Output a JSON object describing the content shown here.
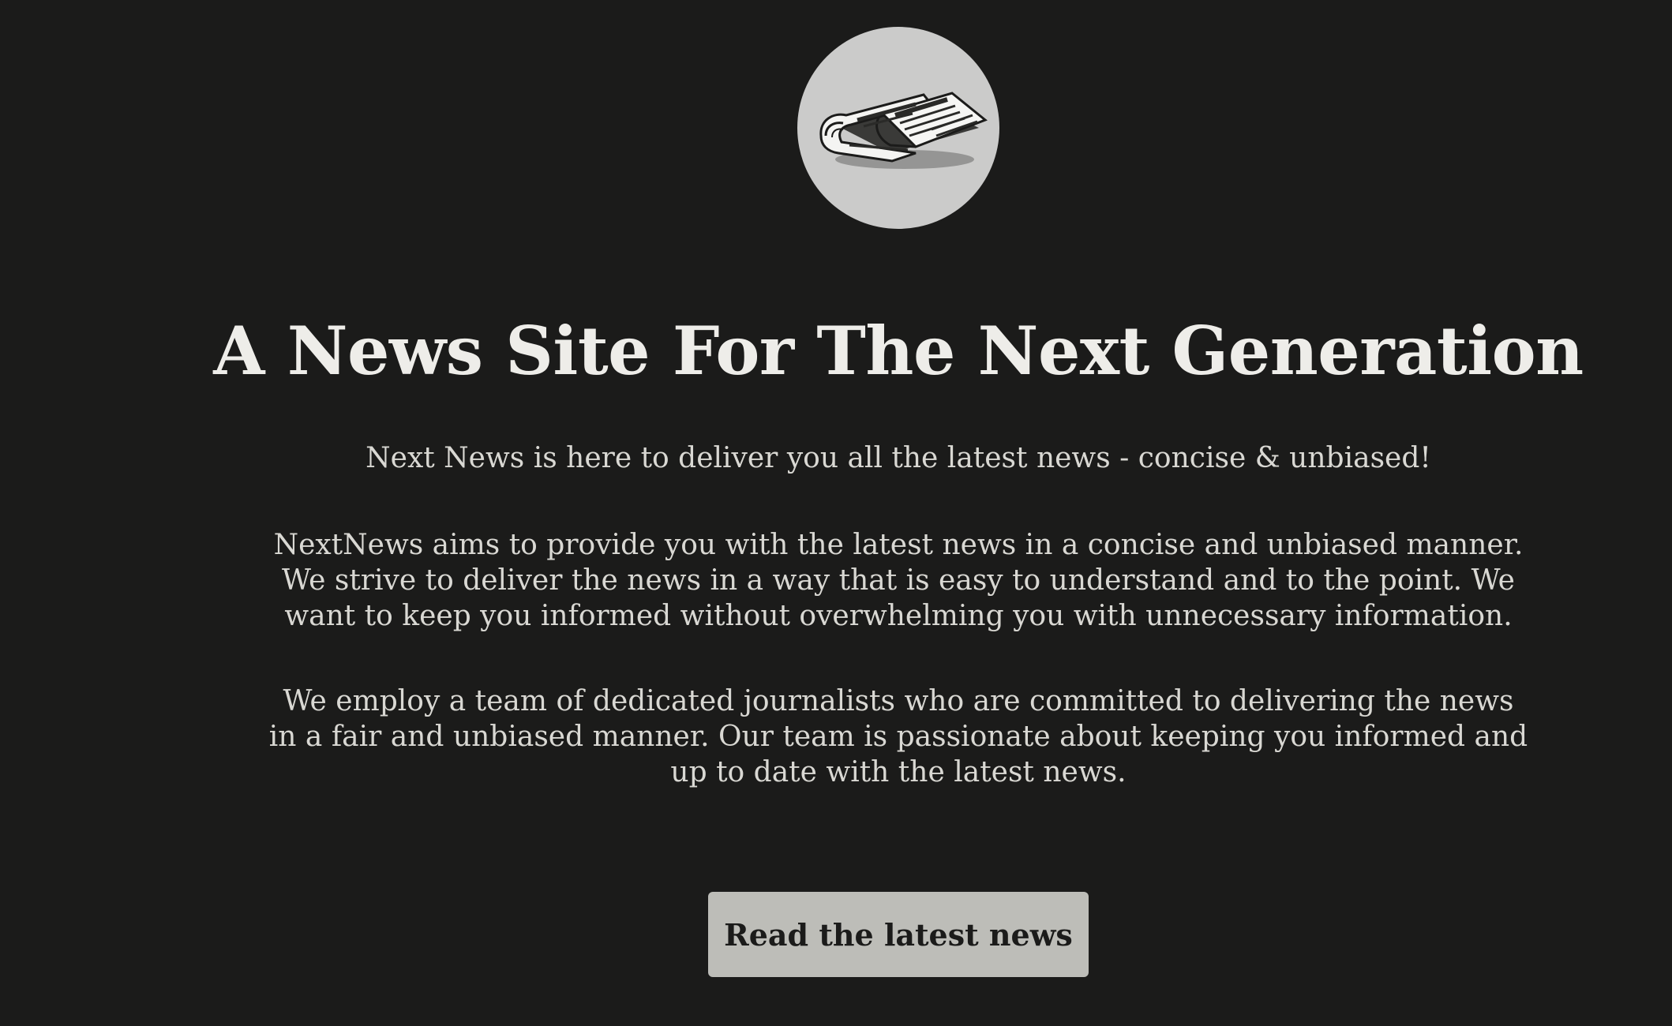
{
  "hero": {
    "logo_icon": "newspaper-icon",
    "headline": "A News Site For The Next Generation",
    "tagline": "Next News is here to deliver you all the latest news - concise & unbiased!",
    "paragraphs": [
      "NextNews aims to provide you with the latest news in a concise and unbiased manner. We strive to deliver the news in a way that is easy to understand and to the point. We want to keep you informed without overwhelming you with unnecessary information.",
      "We employ a team of dedicated journalists who are committed to delivering the news in a fair and unbiased manner. Our team is passionate about keeping you informed and up to date with the latest news."
    ],
    "cta_label": "Read the latest news"
  },
  "colors": {
    "background": "#1b1b1a",
    "text": "#e9e8e4",
    "logo_circle": "#cbcbca",
    "button": "#bdbdb8"
  }
}
